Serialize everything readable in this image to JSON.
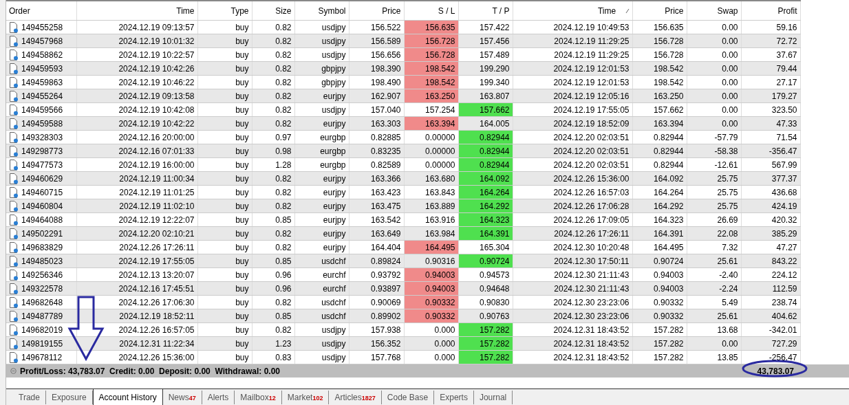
{
  "table": {
    "columns": [
      "Order",
      "Time",
      "Type",
      "Size",
      "Symbol",
      "Price",
      "S / L",
      "T / P",
      "Time",
      "Price",
      "Swap",
      "Profit"
    ],
    "rows": [
      {
        "cells": [
          "149455258",
          "2024.12.19 09:13:57",
          "buy",
          "0.82",
          "usdjpy",
          "156.522",
          "156.635",
          "157.422",
          "2024.12.19 10:49:53",
          "156.635",
          "0.00",
          "59.16"
        ],
        "sl_hit": true,
        "tp_hit": false
      },
      {
        "cells": [
          "149457968",
          "2024.12.19 10:01:32",
          "buy",
          "0.82",
          "usdjpy",
          "156.589",
          "156.728",
          "157.456",
          "2024.12.19 11:29:25",
          "156.728",
          "0.00",
          "72.72"
        ],
        "sl_hit": true,
        "tp_hit": false
      },
      {
        "cells": [
          "149458862",
          "2024.12.19 10:22:57",
          "buy",
          "0.82",
          "usdjpy",
          "156.656",
          "156.728",
          "157.489",
          "2024.12.19 11:29:25",
          "156.728",
          "0.00",
          "37.67"
        ],
        "sl_hit": true,
        "tp_hit": false
      },
      {
        "cells": [
          "149459593",
          "2024.12.19 10:42:26",
          "buy",
          "0.82",
          "gbpjpy",
          "198.390",
          "198.542",
          "199.290",
          "2024.12.19 12:01:53",
          "198.542",
          "0.00",
          "79.44"
        ],
        "sl_hit": true,
        "tp_hit": false
      },
      {
        "cells": [
          "149459863",
          "2024.12.19 10:46:22",
          "buy",
          "0.82",
          "gbpjpy",
          "198.490",
          "198.542",
          "199.340",
          "2024.12.19 12:01:53",
          "198.542",
          "0.00",
          "27.17"
        ],
        "sl_hit": true,
        "tp_hit": false
      },
      {
        "cells": [
          "149455264",
          "2024.12.19 09:13:58",
          "buy",
          "0.82",
          "eurjpy",
          "162.907",
          "163.250",
          "163.807",
          "2024.12.19 12:05:16",
          "163.250",
          "0.00",
          "179.27"
        ],
        "sl_hit": true,
        "tp_hit": false
      },
      {
        "cells": [
          "149459566",
          "2024.12.19 10:42:08",
          "buy",
          "0.82",
          "usdjpy",
          "157.040",
          "157.254",
          "157.662",
          "2024.12.19 17:55:05",
          "157.662",
          "0.00",
          "323.50"
        ],
        "sl_hit": false,
        "tp_hit": true
      },
      {
        "cells": [
          "149459588",
          "2024.12.19 10:42:22",
          "buy",
          "0.82",
          "eurjpy",
          "163.303",
          "163.394",
          "164.005",
          "2024.12.19 18:52:09",
          "163.394",
          "0.00",
          "47.33"
        ],
        "sl_hit": true,
        "tp_hit": false
      },
      {
        "cells": [
          "149328303",
          "2024.12.16 20:00:00",
          "buy",
          "0.97",
          "eurgbp",
          "0.82885",
          "0.00000",
          "0.82944",
          "2024.12.20 02:03:51",
          "0.82944",
          "-57.79",
          "71.54"
        ],
        "sl_hit": false,
        "tp_hit": true
      },
      {
        "cells": [
          "149298773",
          "2024.12.16 07:01:33",
          "buy",
          "0.98",
          "eurgbp",
          "0.83235",
          "0.00000",
          "0.82944",
          "2024.12.20 02:03:51",
          "0.82944",
          "-58.38",
          "-356.47"
        ],
        "sl_hit": false,
        "tp_hit": true
      },
      {
        "cells": [
          "149477573",
          "2024.12.19 16:00:00",
          "buy",
          "1.28",
          "eurgbp",
          "0.82589",
          "0.00000",
          "0.82944",
          "2024.12.20 02:03:51",
          "0.82944",
          "-12.61",
          "567.99"
        ],
        "sl_hit": false,
        "tp_hit": true
      },
      {
        "cells": [
          "149460629",
          "2024.12.19 11:00:34",
          "buy",
          "0.82",
          "eurjpy",
          "163.366",
          "163.680",
          "164.092",
          "2024.12.26 15:36:00",
          "164.092",
          "25.75",
          "377.37"
        ],
        "sl_hit": false,
        "tp_hit": true
      },
      {
        "cells": [
          "149460715",
          "2024.12.19 11:01:25",
          "buy",
          "0.82",
          "eurjpy",
          "163.423",
          "163.843",
          "164.264",
          "2024.12.26 16:57:03",
          "164.264",
          "25.75",
          "436.68"
        ],
        "sl_hit": false,
        "tp_hit": true
      },
      {
        "cells": [
          "149460804",
          "2024.12.19 11:02:10",
          "buy",
          "0.82",
          "eurjpy",
          "163.475",
          "163.889",
          "164.292",
          "2024.12.26 17:06:28",
          "164.292",
          "25.75",
          "424.19"
        ],
        "sl_hit": false,
        "tp_hit": true
      },
      {
        "cells": [
          "149464088",
          "2024.12.19 12:22:07",
          "buy",
          "0.85",
          "eurjpy",
          "163.542",
          "163.916",
          "164.323",
          "2024.12.26 17:09:05",
          "164.323",
          "26.69",
          "420.32"
        ],
        "sl_hit": false,
        "tp_hit": true
      },
      {
        "cells": [
          "149502291",
          "2024.12.20 02:10:21",
          "buy",
          "0.82",
          "eurjpy",
          "163.649",
          "163.984",
          "164.391",
          "2024.12.26 17:26:11",
          "164.391",
          "22.08",
          "385.29"
        ],
        "sl_hit": false,
        "tp_hit": true
      },
      {
        "cells": [
          "149683829",
          "2024.12.26 17:26:11",
          "buy",
          "0.82",
          "eurjpy",
          "164.404",
          "164.495",
          "165.304",
          "2024.12.30 10:20:48",
          "164.495",
          "7.32",
          "47.27"
        ],
        "sl_hit": true,
        "tp_hit": false
      },
      {
        "cells": [
          "149485023",
          "2024.12.19 17:55:05",
          "buy",
          "0.85",
          "usdchf",
          "0.89824",
          "0.90316",
          "0.90724",
          "2024.12.30 17:50:11",
          "0.90724",
          "25.61",
          "843.22"
        ],
        "sl_hit": false,
        "tp_hit": true
      },
      {
        "cells": [
          "149256346",
          "2024.12.13 13:20:07",
          "buy",
          "0.96",
          "eurchf",
          "0.93792",
          "0.94003",
          "0.94573",
          "2024.12.30 21:11:43",
          "0.94003",
          "-2.40",
          "224.12"
        ],
        "sl_hit": true,
        "tp_hit": false
      },
      {
        "cells": [
          "149322578",
          "2024.12.16 17:45:51",
          "buy",
          "0.96",
          "eurchf",
          "0.93897",
          "0.94003",
          "0.94648",
          "2024.12.30 21:11:43",
          "0.94003",
          "-2.24",
          "112.59"
        ],
        "sl_hit": true,
        "tp_hit": false
      },
      {
        "cells": [
          "149682648",
          "2024.12.26 17:06:30",
          "buy",
          "0.82",
          "usdchf",
          "0.90069",
          "0.90332",
          "0.90830",
          "2024.12.30 23:23:06",
          "0.90332",
          "5.49",
          "238.74"
        ],
        "sl_hit": true,
        "tp_hit": false
      },
      {
        "cells": [
          "149487789",
          "2024.12.19 18:52:11",
          "buy",
          "0.85",
          "usdchf",
          "0.89902",
          "0.90332",
          "0.90763",
          "2024.12.30 23:23:06",
          "0.90332",
          "25.61",
          "404.62"
        ],
        "sl_hit": true,
        "tp_hit": false
      },
      {
        "cells": [
          "149682019",
          "2024.12.26 16:57:05",
          "buy",
          "0.82",
          "usdjpy",
          "157.938",
          "0.000",
          "157.282",
          "2024.12.31 18:43:52",
          "157.282",
          "13.68",
          "-342.01"
        ],
        "sl_hit": false,
        "tp_hit": true
      },
      {
        "cells": [
          "149819155",
          "2024.12.31 11:22:34",
          "buy",
          "1.23",
          "usdjpy",
          "156.352",
          "0.000",
          "157.282",
          "2024.12.31 18:43:52",
          "157.282",
          "0.00",
          "727.29"
        ],
        "sl_hit": false,
        "tp_hit": true
      },
      {
        "cells": [
          "149678112",
          "2024.12.26 15:36:00",
          "buy",
          "0.83",
          "usdjpy",
          "157.768",
          "0.000",
          "157.282",
          "2024.12.31 18:43:52",
          "157.282",
          "13.85",
          "-256.47"
        ],
        "sl_hit": false,
        "tp_hit": true
      }
    ]
  },
  "summary": {
    "text": "Profit/Loss: 43,783.07  Credit: 0.00  Deposit: 0.00  Withdrawal: 0.00",
    "total": "43,783.07"
  },
  "tabs": [
    {
      "label": "Trade",
      "selected": false
    },
    {
      "label": "Exposure",
      "selected": false
    },
    {
      "label": "Account History",
      "selected": true
    },
    {
      "label": "News",
      "badge": "47",
      "selected": false
    },
    {
      "label": "Alerts",
      "selected": false
    },
    {
      "label": "Mailbox",
      "badge": "12",
      "selected": false
    },
    {
      "label": "Market",
      "badge": "102",
      "selected": false
    },
    {
      "label": "Articles",
      "badge": "1827",
      "selected": false
    },
    {
      "label": "Code Base",
      "selected": false
    },
    {
      "label": "Experts",
      "selected": false
    },
    {
      "label": "Journal",
      "selected": false
    }
  ]
}
